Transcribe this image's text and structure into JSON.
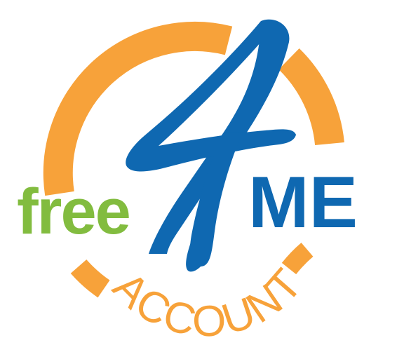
{
  "logo": {
    "word_free": "free",
    "numeral": "4",
    "word_me": "ME",
    "word_account": "ACCOUNT",
    "colors": {
      "orange": "#F7A23A",
      "green": "#82BC3F",
      "blue": "#0F68B1",
      "background": "#FFFFFF"
    }
  }
}
